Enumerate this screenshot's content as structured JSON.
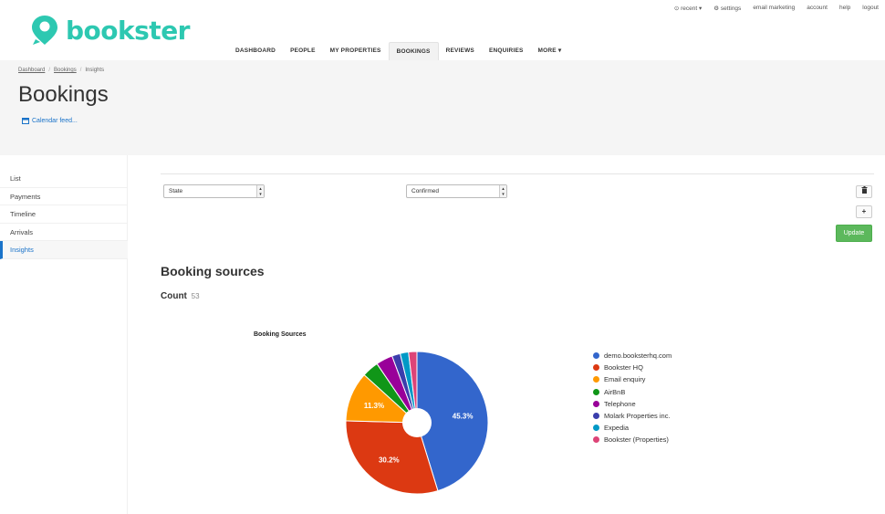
{
  "brand": {
    "name": "bookster",
    "color": "#2dc8b1"
  },
  "util_nav": [
    "⊙ recent ▾",
    "⚙ settings",
    "email marketing",
    "account",
    "help",
    "logout"
  ],
  "main_nav": [
    {
      "label": "DASHBOARD",
      "active": false
    },
    {
      "label": "PEOPLE",
      "active": false
    },
    {
      "label": "MY PROPERTIES",
      "active": false
    },
    {
      "label": "BOOKINGS",
      "active": true
    },
    {
      "label": "REVIEWS",
      "active": false
    },
    {
      "label": "ENQUIRIES",
      "active": false
    },
    {
      "label": "MORE ▾",
      "active": false
    }
  ],
  "breadcrumb": {
    "dashboard": "Dashboard",
    "bookings": "Bookings",
    "current": "Insights",
    "sep": "/"
  },
  "page_title": "Bookings",
  "calendar_feed": "Calendar feed...",
  "sidebar": {
    "items": [
      {
        "label": "List",
        "active": false
      },
      {
        "label": "Payments",
        "active": false
      },
      {
        "label": "Timeline",
        "active": false
      },
      {
        "label": "Arrivals",
        "active": false
      },
      {
        "label": "Insights",
        "active": true
      }
    ]
  },
  "filters": {
    "field": "State",
    "value": "Confirmed"
  },
  "buttons": {
    "delete_icon": "trash-icon",
    "add_icon": "plus-icon",
    "update": "Update",
    "update_color": "#5cb85c"
  },
  "section_title": "Booking sources",
  "count": {
    "label": "Count",
    "value": "53"
  },
  "chart_data": {
    "type": "pie",
    "title": "Booking Sources",
    "donut_hole": true,
    "legend_position": "right",
    "slices": [
      {
        "name": "demo.booksterhq.com",
        "value": 45.3,
        "color": "#3366cc",
        "label": "45.3%"
      },
      {
        "name": "Bookster HQ",
        "value": 30.2,
        "color": "#dc3912",
        "label": "30.2%"
      },
      {
        "name": "Email enquiry",
        "value": 11.3,
        "color": "#ff9900",
        "label": "11.3%"
      },
      {
        "name": "AirBnB",
        "value": 3.8,
        "color": "#109618",
        "label": ""
      },
      {
        "name": "Telephone",
        "value": 3.8,
        "color": "#990099",
        "label": ""
      },
      {
        "name": "Molark Properties inc.",
        "value": 1.9,
        "color": "#3b3eac",
        "label": ""
      },
      {
        "name": "Expedia",
        "value": 1.9,
        "color": "#0099c6",
        "label": ""
      },
      {
        "name": "Bookster (Properties)",
        "value": 1.9,
        "color": "#dd4477",
        "label": ""
      }
    ]
  }
}
